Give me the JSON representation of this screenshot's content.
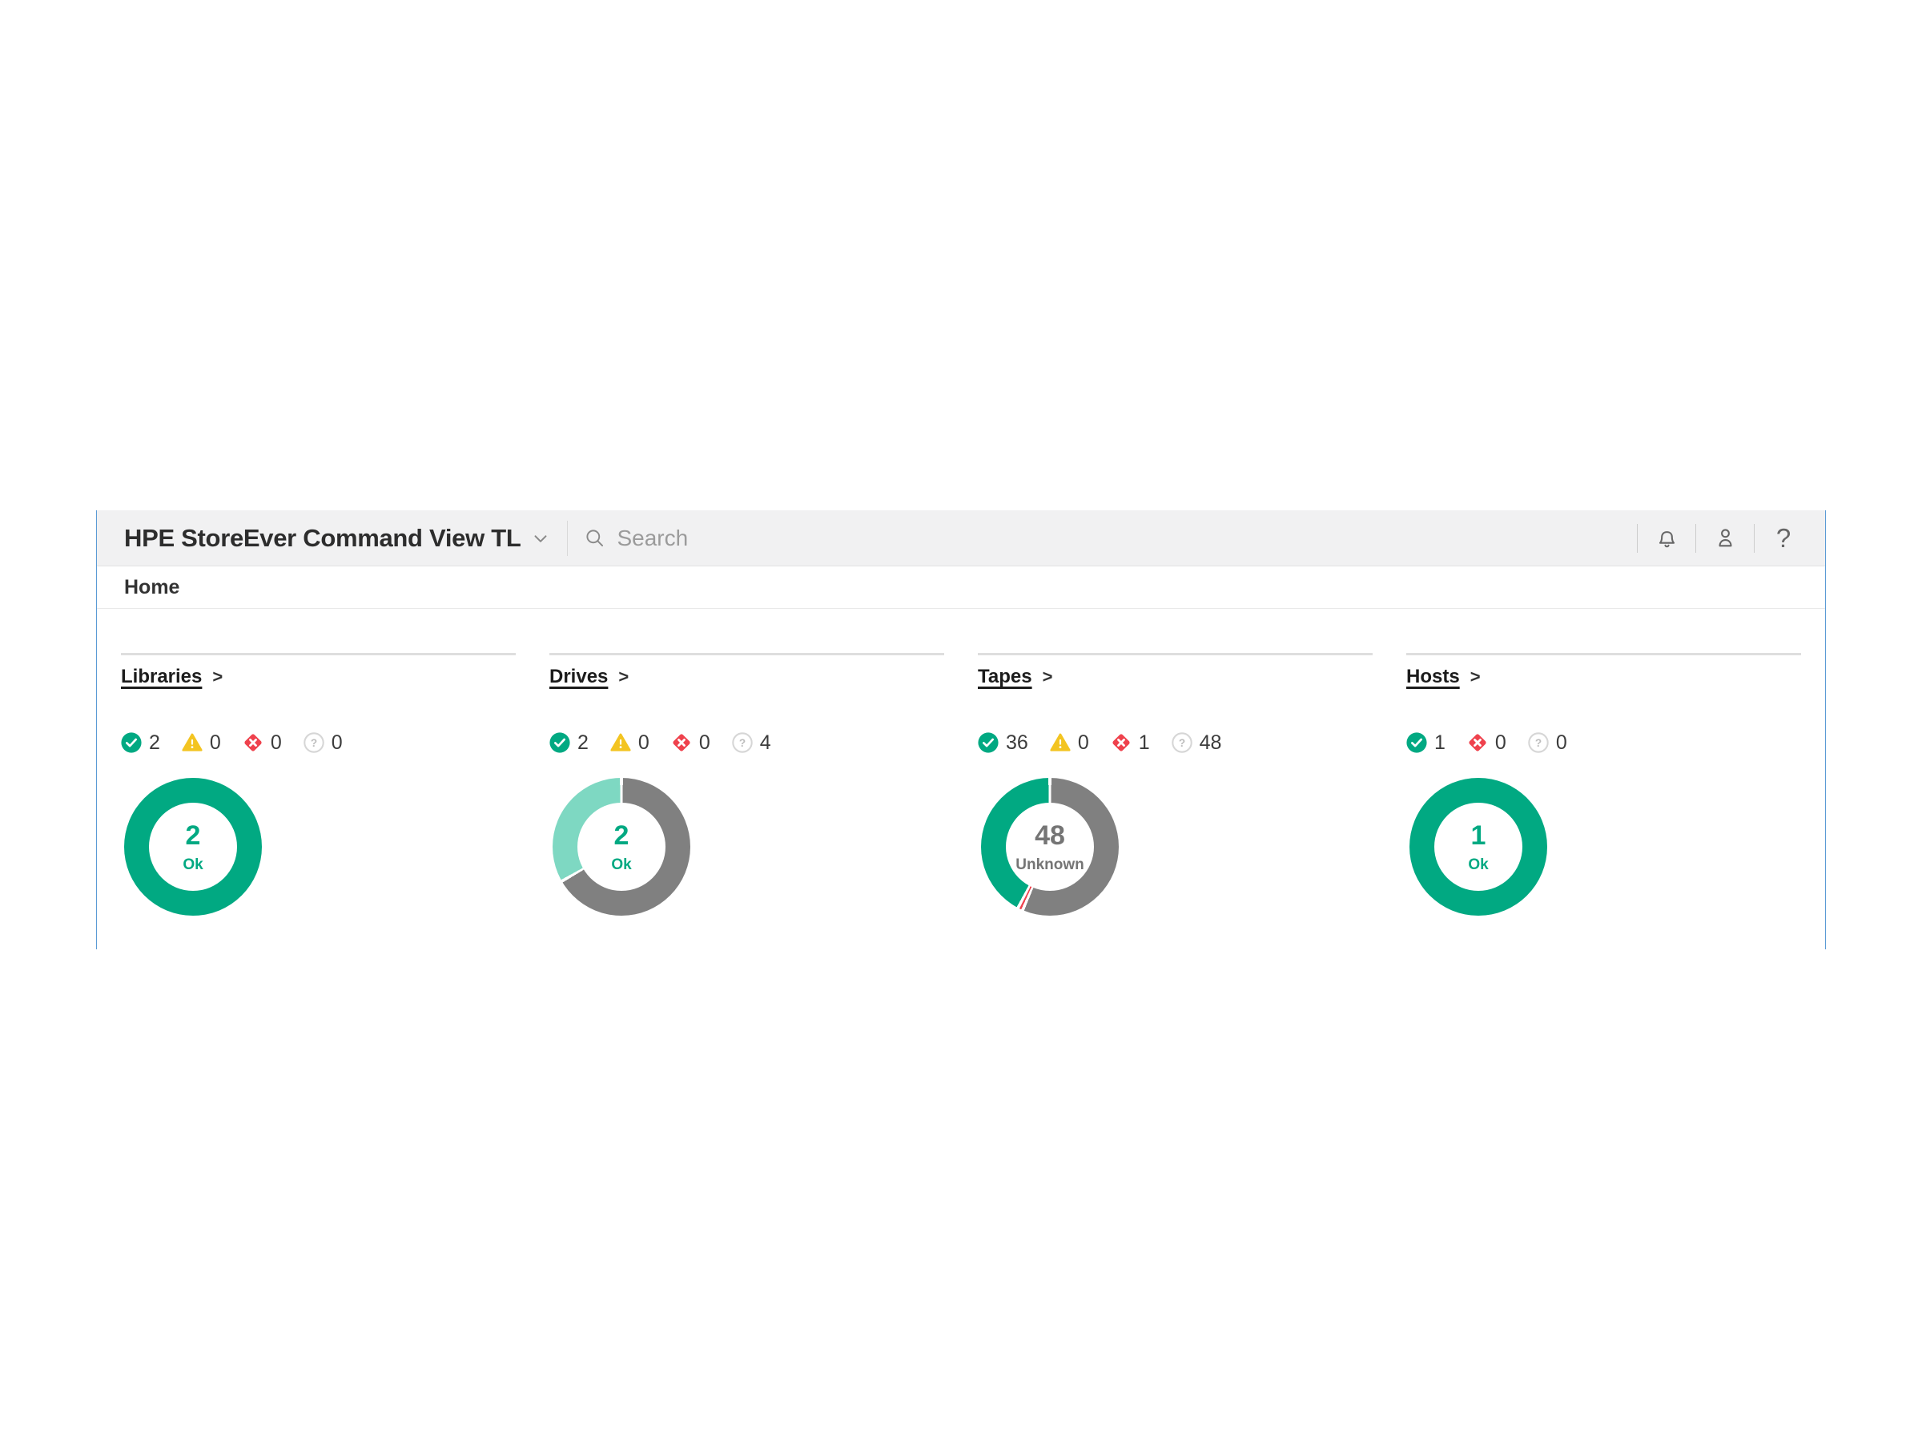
{
  "header": {
    "app_title": "HPE StoreEver Command View TL",
    "search_placeholder": "Search",
    "help_glyph": "?"
  },
  "breadcrumb": {
    "label": "Home"
  },
  "colors": {
    "ok": "#01A982",
    "ok_light": "#7ED8C2",
    "warning": "#F3C421",
    "critical": "#EF424D",
    "unknown": "#808080",
    "unknown_text": "#757575",
    "accent_border": "#5B9BD5"
  },
  "panels": [
    {
      "title": "Libraries",
      "link_arrow": ">",
      "statuses": [
        {
          "type": "ok",
          "icon": "check-circle-icon",
          "count": 2
        },
        {
          "type": "warning",
          "icon": "warning-triangle-icon",
          "count": 0
        },
        {
          "type": "critical",
          "icon": "critical-diamond-icon",
          "count": 0
        },
        {
          "type": "unknown",
          "icon": "unknown-circle-icon",
          "count": 0
        }
      ],
      "donut": {
        "type": "donut",
        "center_value": "2",
        "center_label": "Ok",
        "center_color": "#01A982",
        "segments": [
          {
            "status": "ok",
            "color": "ok",
            "value": 2
          }
        ]
      }
    },
    {
      "title": "Drives",
      "link_arrow": ">",
      "statuses": [
        {
          "type": "ok",
          "icon": "check-circle-icon",
          "count": 2
        },
        {
          "type": "warning",
          "icon": "warning-triangle-icon",
          "count": 0
        },
        {
          "type": "critical",
          "icon": "critical-diamond-icon",
          "count": 0
        },
        {
          "type": "unknown",
          "icon": "unknown-circle-icon",
          "count": 4
        }
      ],
      "donut": {
        "type": "donut",
        "center_value": "2",
        "center_label": "Ok",
        "center_color": "#01A982",
        "segments": [
          {
            "status": "unknown",
            "color": "unknown",
            "value": 4
          },
          {
            "status": "ok",
            "color": "ok_light",
            "value": 2
          }
        ]
      }
    },
    {
      "title": "Tapes",
      "link_arrow": ">",
      "statuses": [
        {
          "type": "ok",
          "icon": "check-circle-icon",
          "count": 36
        },
        {
          "type": "warning",
          "icon": "warning-triangle-icon",
          "count": 0
        },
        {
          "type": "critical",
          "icon": "critical-diamond-icon",
          "count": 1
        },
        {
          "type": "unknown",
          "icon": "unknown-circle-icon",
          "count": 48
        }
      ],
      "donut": {
        "type": "donut",
        "center_value": "48",
        "center_label": "Unknown",
        "center_color": "#757575",
        "segments": [
          {
            "status": "unknown",
            "color": "unknown",
            "value": 48
          },
          {
            "status": "critical",
            "color": "critical",
            "value": 1
          },
          {
            "status": "ok",
            "color": "ok",
            "value": 36
          }
        ]
      }
    },
    {
      "title": "Hosts",
      "link_arrow": ">",
      "statuses": [
        {
          "type": "ok",
          "icon": "check-circle-icon",
          "count": 1
        },
        {
          "type": "critical",
          "icon": "critical-diamond-icon",
          "count": 0
        },
        {
          "type": "unknown",
          "icon": "unknown-circle-icon",
          "count": 0
        }
      ],
      "donut": {
        "type": "donut",
        "center_value": "1",
        "center_label": "Ok",
        "center_color": "#01A982",
        "segments": [
          {
            "status": "ok",
            "color": "ok",
            "value": 1
          }
        ]
      }
    }
  ]
}
